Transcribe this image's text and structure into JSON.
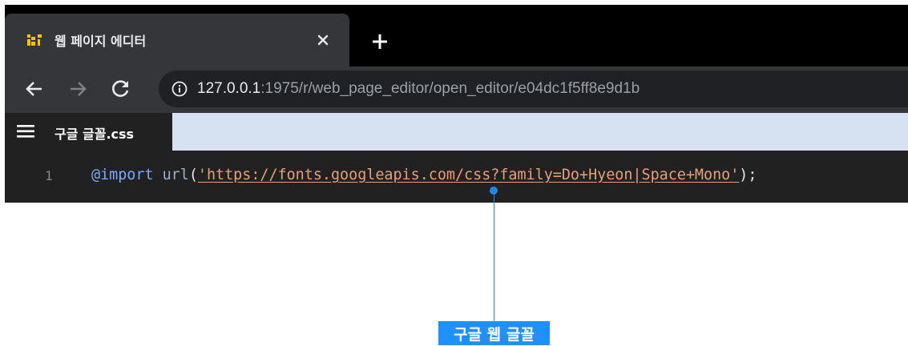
{
  "browser": {
    "tab": {
      "favicon_label": "k[",
      "title": "웹 페이지 에디터",
      "close_icon": "close-icon"
    },
    "new_tab_icon": "plus-icon",
    "toolbar": {
      "back_icon": "arrow-left-icon",
      "forward_icon": "arrow-right-icon",
      "reload_icon": "reload-icon",
      "info_icon": "info-icon",
      "url_host": "127.0.0.1",
      "url_path": ":1975/r/web_page_editor/open_editor/e04dc1f5ff8e9d1b"
    }
  },
  "editor": {
    "menu_icon": "hamburger-menu-icon",
    "file_name": "구글 글꼴.css",
    "line_number": "1",
    "code": {
      "at_rule": "@import",
      "space": " ",
      "fn": "url",
      "open": "(",
      "string": "'https://fonts.googleapis.com/css?family=Do+Hyeon|Space+Mono'",
      "close": ");"
    }
  },
  "annotation": {
    "label": "구글 웹 글꼴",
    "color": "#1e90ff"
  },
  "colors": {
    "tab_strip": "#000000",
    "toolbar": "#35363a",
    "editor_bg": "#212121",
    "file_tabbar": "#d6e2f1",
    "keyword": "#78a9ff",
    "string": "#e89e79"
  }
}
